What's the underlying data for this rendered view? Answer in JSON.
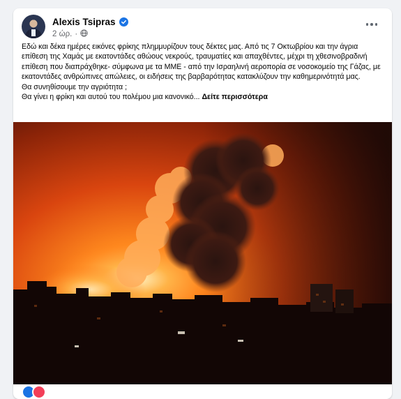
{
  "post": {
    "author": "Alexis Tsipras",
    "time": "2 ώρ.",
    "paragraphs": [
      "Εδώ και δέκα ημέρες εικόνες φρίκης πλημμυρίζουν τους δέκτες μας. Από τις 7 Οκτωβρίου και την άγρια επίθεση της Χαμάς με εκατοντάδες αθώους νεκρούς, τραυματίες και απαχθέντες, μέχρι τη χθεσινοβραδινή επίθεση που διαπράχθηκε- σύμφωνα με τα ΜΜΕ - από την Ισραηλινή αεροπορία σε νοσοκομείο της Γάζας, με εκατοντάδες ανθρώπινες απώλειες, οι ειδήσεις της βαρβαρότητας κατακλύζουν την καθημερινότητά μας.",
      "Θα συνηθίσουμε την αγριότητα ;"
    ],
    "last_line": "Θα γίνει η φρίκη και αυτού του πολέμου μια κανονικό...",
    "see_more": "Δείτε περισσότερα"
  },
  "icons": {
    "verified": "verified-badge-icon",
    "audience": "globe-icon",
    "options": "more-options-icon"
  },
  "colors": {
    "accent": "#1b74e4",
    "text": "#050505",
    "secondary_text": "#65676b"
  }
}
